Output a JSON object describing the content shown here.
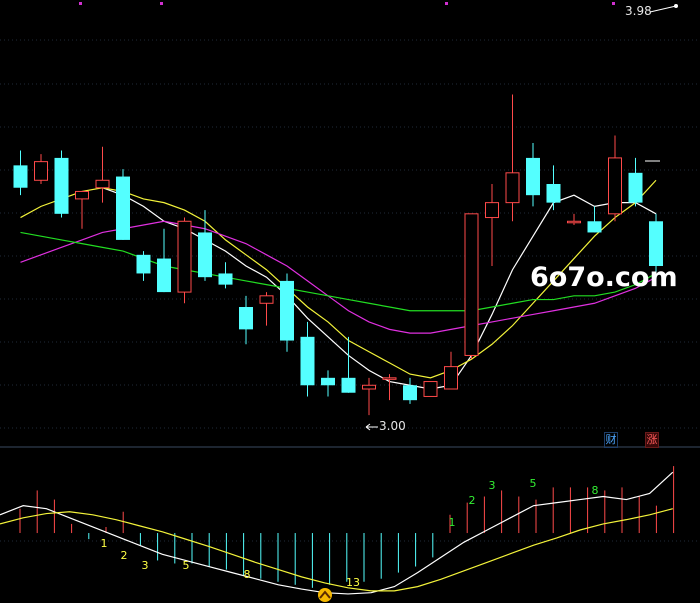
{
  "colors": {
    "background": "#000000",
    "grid": "#1f2a38",
    "up": "#ff4a4a",
    "down": "#54ffff",
    "ma_white": "#ffffff",
    "ma_yellow": "#f3f33a",
    "ma_magenta": "#e030e0",
    "ma_green": "#22dd22",
    "count_green": "#33ee33",
    "count_yellow": "#ffff44"
  },
  "labels": {
    "price_high": "3.98",
    "price_low": "3.00",
    "watermark": "6o7o.com",
    "badge_cai": "财",
    "badge_zhang": "涨"
  },
  "markers": {
    "up_arrow_icon": "chevron-up-icon"
  },
  "chart_data": [
    {
      "type": "candlestick",
      "ylim": [
        2.95,
        4.05
      ],
      "candles": [
        {
          "o": 3.66,
          "h": 3.7,
          "l": 3.58,
          "c": 3.6
        },
        {
          "o": 3.62,
          "h": 3.69,
          "l": 3.61,
          "c": 3.67
        },
        {
          "o": 3.68,
          "h": 3.7,
          "l": 3.52,
          "c": 3.53
        },
        {
          "o": 3.57,
          "h": 3.59,
          "l": 3.49,
          "c": 3.59
        },
        {
          "o": 3.6,
          "h": 3.71,
          "l": 3.56,
          "c": 3.62
        },
        {
          "o": 3.63,
          "h": 3.65,
          "l": 3.46,
          "c": 3.46
        },
        {
          "o": 3.42,
          "h": 3.43,
          "l": 3.35,
          "c": 3.37
        },
        {
          "o": 3.41,
          "h": 3.49,
          "l": 3.32,
          "c": 3.32
        },
        {
          "o": 3.32,
          "h": 3.52,
          "l": 3.29,
          "c": 3.51
        },
        {
          "o": 3.48,
          "h": 3.54,
          "l": 3.35,
          "c": 3.36
        },
        {
          "o": 3.37,
          "h": 3.4,
          "l": 3.33,
          "c": 3.34
        },
        {
          "o": 3.28,
          "h": 3.31,
          "l": 3.18,
          "c": 3.22
        },
        {
          "o": 3.29,
          "h": 3.32,
          "l": 3.23,
          "c": 3.31
        },
        {
          "o": 3.35,
          "h": 3.37,
          "l": 3.16,
          "c": 3.19
        },
        {
          "o": 3.2,
          "h": 3.24,
          "l": 3.04,
          "c": 3.07
        },
        {
          "o": 3.09,
          "h": 3.11,
          "l": 3.04,
          "c": 3.07
        },
        {
          "o": 3.09,
          "h": 3.2,
          "l": 3.05,
          "c": 3.05
        },
        {
          "o": 3.06,
          "h": 3.09,
          "l": 2.99,
          "c": 3.07
        },
        {
          "o": 3.09,
          "h": 3.1,
          "l": 3.03,
          "c": 3.09
        },
        {
          "o": 3.07,
          "h": 3.09,
          "l": 3.02,
          "c": 3.03
        },
        {
          "o": 3.04,
          "h": 3.08,
          "l": 3.04,
          "c": 3.08
        },
        {
          "o": 3.06,
          "h": 3.16,
          "l": 3.06,
          "c": 3.12
        },
        {
          "o": 3.15,
          "h": 3.53,
          "l": 3.14,
          "c": 3.53
        },
        {
          "o": 3.52,
          "h": 3.61,
          "l": 3.39,
          "c": 3.56
        },
        {
          "o": 3.56,
          "h": 3.85,
          "l": 3.51,
          "c": 3.64
        },
        {
          "o": 3.68,
          "h": 3.72,
          "l": 3.55,
          "c": 3.58
        },
        {
          "o": 3.61,
          "h": 3.66,
          "l": 3.54,
          "c": 3.56
        },
        {
          "o": 3.51,
          "h": 3.53,
          "l": 3.5,
          "c": 3.51
        },
        {
          "o": 3.51,
          "h": 3.55,
          "l": 3.48,
          "c": 3.48
        },
        {
          "o": 3.53,
          "h": 3.74,
          "l": 3.51,
          "c": 3.68
        },
        {
          "o": 3.64,
          "h": 3.68,
          "l": 3.55,
          "c": 3.56
        },
        {
          "o": 3.51,
          "h": 3.53,
          "l": 3.34,
          "c": 3.39
        }
      ],
      "moving_averages": [
        {
          "color": "white",
          "values": [
            null,
            null,
            null,
            null,
            3.6,
            3.58,
            3.55,
            3.51,
            3.49,
            3.46,
            3.43,
            3.39,
            3.36,
            3.31,
            3.25,
            3.2,
            3.15,
            3.11,
            3.08,
            3.07,
            3.06,
            3.07,
            3.15,
            3.26,
            3.38,
            3.47,
            3.56,
            3.58,
            3.55,
            3.56,
            3.56,
            3.53
          ]
        },
        {
          "color": "yellow",
          "values": [
            3.52,
            3.55,
            3.57,
            3.59,
            3.6,
            3.59,
            3.57,
            3.56,
            3.54,
            3.51,
            3.46,
            3.42,
            3.38,
            3.33,
            3.28,
            3.24,
            3.19,
            3.16,
            3.13,
            3.1,
            3.09,
            3.11,
            3.14,
            3.18,
            3.23,
            3.29,
            3.35,
            3.41,
            3.47,
            3.52,
            3.56,
            3.62
          ]
        },
        {
          "color": "magenta",
          "values": [
            3.4,
            3.42,
            3.44,
            3.46,
            3.48,
            3.49,
            3.5,
            3.51,
            3.5,
            3.49,
            3.47,
            3.45,
            3.42,
            3.39,
            3.35,
            3.31,
            3.27,
            3.24,
            3.22,
            3.21,
            3.21,
            3.22,
            3.23,
            3.24,
            3.25,
            3.26,
            3.27,
            3.28,
            3.29,
            3.31,
            3.33,
            3.36
          ]
        },
        {
          "color": "green",
          "values": [
            3.48,
            3.47,
            3.46,
            3.45,
            3.44,
            3.43,
            3.41,
            3.39,
            3.38,
            3.37,
            3.36,
            3.35,
            3.34,
            3.33,
            3.32,
            3.31,
            3.3,
            3.29,
            3.28,
            3.27,
            3.27,
            3.27,
            3.27,
            3.28,
            3.29,
            3.3,
            3.3,
            3.31,
            3.31,
            3.32,
            3.34,
            3.37
          ]
        }
      ]
    },
    {
      "type": "bar",
      "ylim": [
        -1.1,
        1.2
      ],
      "baseline": 0,
      "values": [
        0.4,
        0.7,
        0.55,
        0.15,
        -0.1,
        0.1,
        0.35,
        -0.2,
        -0.45,
        -0.5,
        -0.5,
        -0.55,
        -0.6,
        -0.7,
        -0.75,
        -0.8,
        -0.85,
        -0.9,
        -0.85,
        -0.8,
        -0.8,
        -0.75,
        -0.65,
        -0.55,
        -0.4,
        0.3,
        0.5,
        0.6,
        0.7,
        0.6,
        0.55,
        0.75,
        0.75,
        0.75,
        0.7,
        0.75,
        0.6,
        0.45,
        1.1
      ],
      "colors": [
        "up",
        "up",
        "up",
        "up",
        "down",
        "up",
        "up",
        "down",
        "down",
        "down",
        "down",
        "down",
        "down",
        "down",
        "down",
        "down",
        "down",
        "down",
        "down",
        "down",
        "down",
        "down",
        "down",
        "down",
        "down",
        "up",
        "up",
        "up",
        "up",
        "up",
        "up",
        "up",
        "up",
        "up",
        "up",
        "up",
        "up",
        "up",
        "up"
      ],
      "lines": [
        {
          "color": "white",
          "values": [
            0.3,
            0.45,
            0.4,
            0.25,
            0.1,
            -0.05,
            -0.2,
            -0.35,
            -0.45,
            -0.55,
            -0.65,
            -0.75,
            -0.85,
            -0.92,
            -0.98,
            -1.0,
            -0.98,
            -0.88,
            -0.65,
            -0.4,
            -0.15,
            0.05,
            0.25,
            0.45,
            0.5,
            0.55,
            0.6,
            0.55,
            0.65,
            1.0
          ]
        },
        {
          "color": "yellow",
          "values": [
            0.15,
            0.25,
            0.32,
            0.35,
            0.3,
            0.22,
            0.12,
            0.02,
            -0.1,
            -0.22,
            -0.35,
            -0.48,
            -0.6,
            -0.72,
            -0.82,
            -0.9,
            -0.95,
            -0.95,
            -0.88,
            -0.76,
            -0.62,
            -0.48,
            -0.34,
            -0.2,
            -0.08,
            0.05,
            0.15,
            0.22,
            0.3,
            0.4
          ]
        }
      ],
      "annotations": [
        {
          "text": "1",
          "color": "yellow"
        },
        {
          "text": "2",
          "color": "yellow"
        },
        {
          "text": "3",
          "color": "yellow"
        },
        {
          "text": "5",
          "color": "yellow"
        },
        {
          "text": "8",
          "color": "yellow"
        },
        {
          "text": "13",
          "color": "yellow"
        },
        {
          "text": "1",
          "color": "green"
        },
        {
          "text": "2",
          "color": "green"
        },
        {
          "text": "3",
          "color": "green"
        },
        {
          "text": "5",
          "color": "green"
        },
        {
          "text": "8",
          "color": "green"
        }
      ]
    }
  ]
}
